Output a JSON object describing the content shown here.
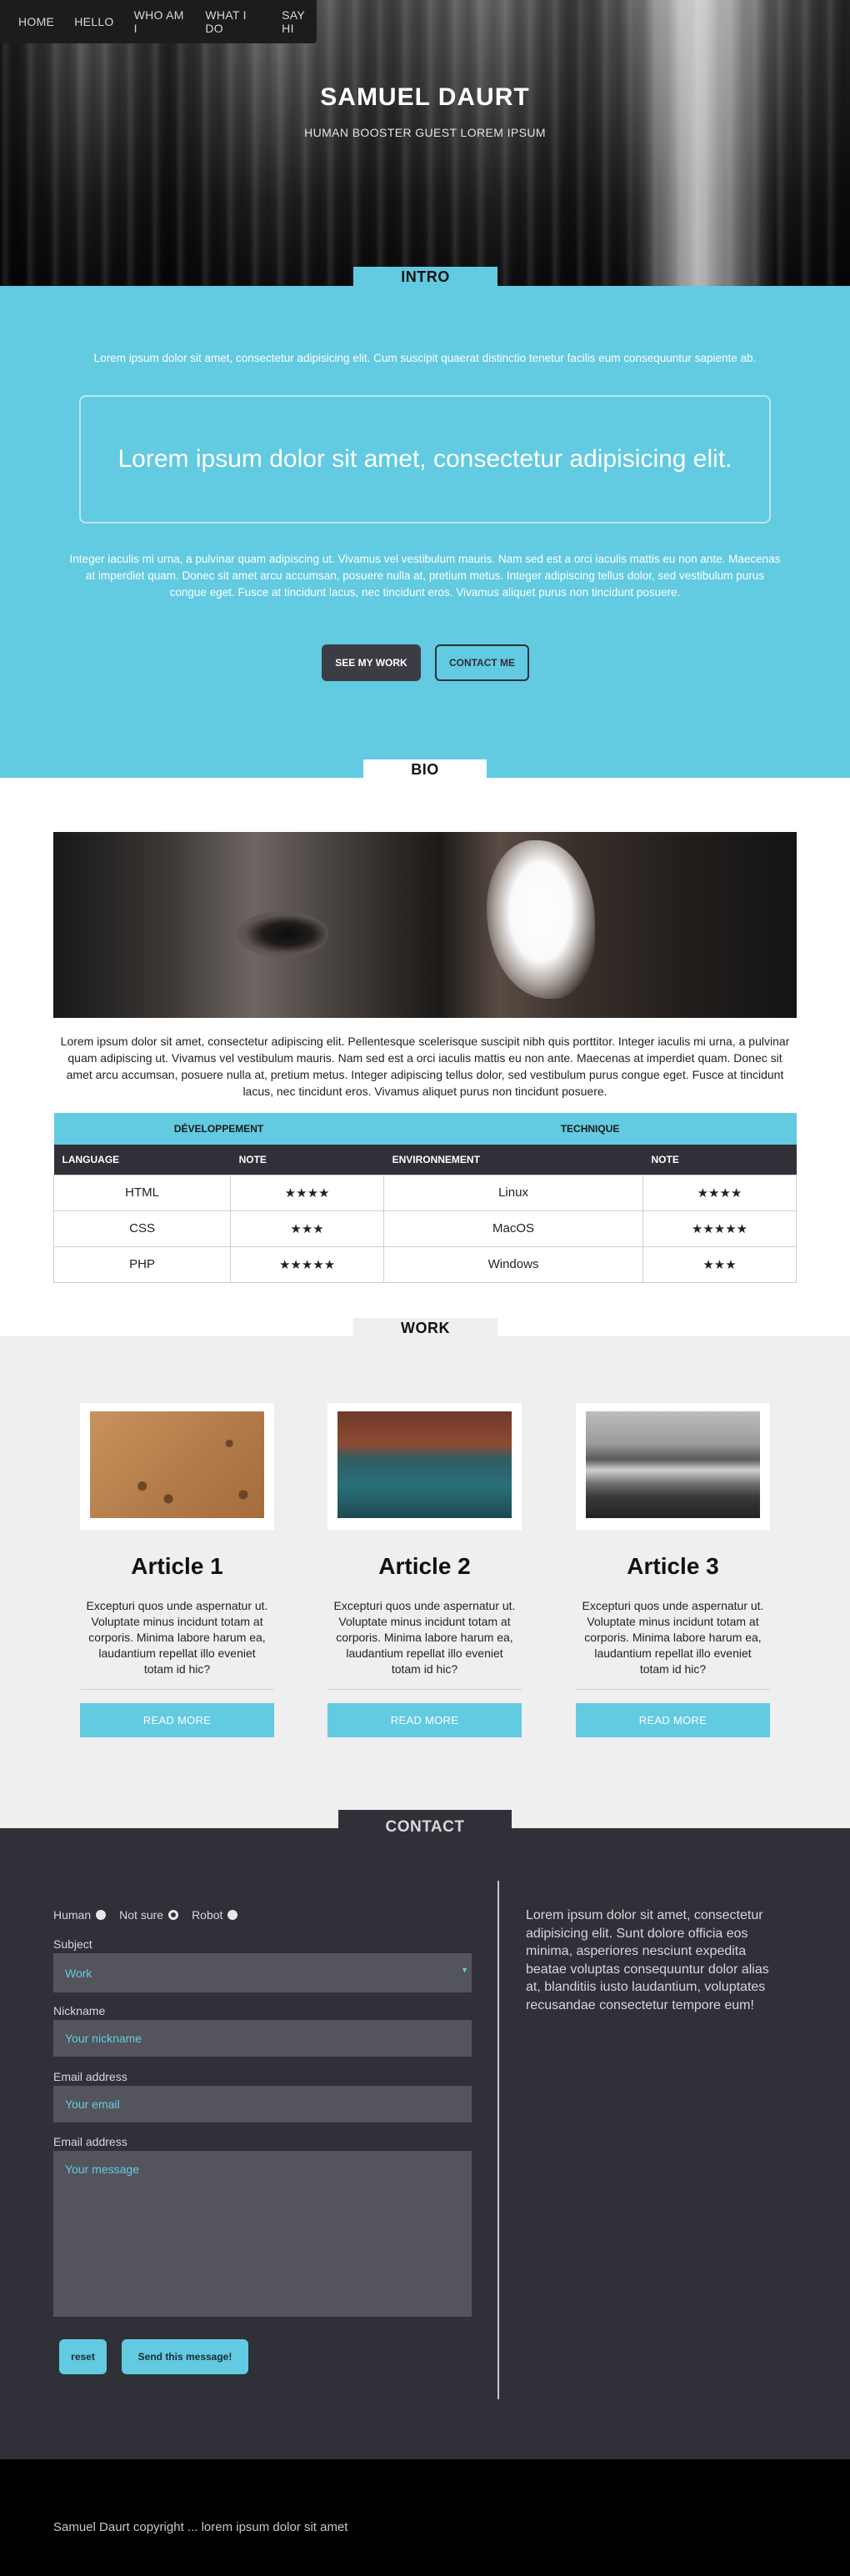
{
  "nav": {
    "items": [
      "HOME",
      "HELLO",
      "WHO AM I",
      "WHAT I DO",
      "SAY HI"
    ]
  },
  "hero": {
    "title": "SAMUEL DAURT",
    "subtitle": "HUMAN BOOSTER GUEST LOREM IPSUM"
  },
  "intro": {
    "tab": "INTRO",
    "text1": "Lorem ipsum dolor sit amet, consectetur adipisicing elit. Cum suscipit quaerat distinctio tenetur facilis eum consequuntur sapiente ab.",
    "quote": "Lorem ipsum dolor sit amet, consectetur adipisicing elit.",
    "text2": "Integer iaculis mi urna, a pulvinar quam adipiscing ut. Vivamus vel vestibulum mauris. Nam sed est a orci iaculis mattis eu non ante. Maecenas at imperdiet quam. Donec sit amet arcu accumsan, posuere nulla at, pretium metus. Integer adipiscing tellus dolor, sed vestibulum purus congue eget. Fusce at tincidunt lacus, nec tincidunt eros. Vivamus aliquet purus non tincidunt posuere.",
    "btn_work": "SEE MY WORK",
    "btn_contact": "CONTACT ME"
  },
  "bio": {
    "tab": "BIO",
    "text": "Lorem ipsum dolor sit amet, consectetur adipiscing elit. Pellentesque scelerisque suscipit nibh quis porttitor. Integer iaculis mi urna, a pulvinar quam adipiscing ut. Vivamus vel vestibulum mauris. Nam sed est a orci iaculis mattis eu non ante. Maecenas at imperdiet quam. Donec sit amet arcu accumsan, posuere nulla at, pretium metus. Integer adipiscing tellus dolor, sed vestibulum purus congue eget. Fusce at tincidunt lacus, nec tincidunt eros. Vivamus aliquet purus non tincidunt posuere.",
    "table": {
      "groups": [
        "DÉVELOPPEMENT",
        "TECHNIQUE"
      ],
      "headers": [
        "LANGUAGE",
        "NOTE",
        "ENVIRONNEMENT",
        "NOTE"
      ],
      "rows": [
        [
          "HTML",
          "★★★★",
          "Linux",
          "★★★★"
        ],
        [
          "CSS",
          "★★★",
          "MacOS",
          "★★★★★"
        ],
        [
          "PHP",
          "★★★★★",
          "Windows",
          "★★★"
        ]
      ]
    }
  },
  "work": {
    "tab": "WORK",
    "articles": [
      {
        "title": "Article 1",
        "text": "Excepturi quos unde aspernatur ut. Voluptate minus incidunt totam at corporis. Minima labore harum ea, laudantium repellat illo eveniet totam id hic?",
        "button": "READ MORE"
      },
      {
        "title": "Article 2",
        "text": "Excepturi quos unde aspernatur ut. Voluptate minus incidunt totam at corporis. Minima labore harum ea, laudantium repellat illo eveniet totam id hic?",
        "button": "READ MORE"
      },
      {
        "title": "Article 3",
        "text": "Excepturi quos unde aspernatur ut. Voluptate minus incidunt totam at corporis. Minima labore harum ea, laudantium repellat illo eveniet totam id hic?",
        "button": "READ MORE"
      }
    ]
  },
  "contact": {
    "tab": "CONTACT",
    "radio_labels": [
      "Human",
      "Not sure",
      "Robot"
    ],
    "selected_radio": "Not sure",
    "subject_label": "Subject",
    "subject_value": "Work",
    "nickname_label": "Nickname",
    "nickname_placeholder": "Your nickname",
    "email_label": "Email address",
    "email_placeholder": "Your email",
    "message_label": "Email address",
    "message_placeholder": "Your message",
    "btn_reset": "reset",
    "btn_send": "Send this message!",
    "side_text": "Lorem ipsum dolor sit amet, consectetur adipisicing elit. Sunt dolore officia eos minima, asperiores nesciunt expedita beatae voluptas consequuntur dolor alias at, blanditiis iusto laudantium, voluptates recusandae consectetur tempore eum!"
  },
  "footer": {
    "text": "Samuel Daurt copyright ... lorem ipsum dolor sit amet"
  },
  "colors": {
    "accent": "#62cae1",
    "dark": "#2f3038",
    "button_dark": "#3c3d44",
    "footer": "#000000",
    "work_bg": "#eeefee"
  }
}
